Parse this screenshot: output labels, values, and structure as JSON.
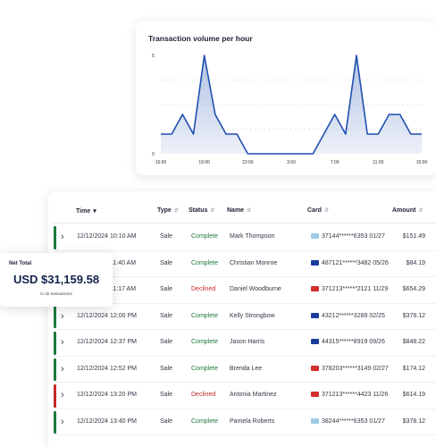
{
  "chart": {
    "title": "Transaction volume per hour",
    "chart_data": {
      "type": "area",
      "title": "Transaction volume per hour",
      "y_ticks": [
        "0",
        "5"
      ],
      "x_ticks": [
        "15:00",
        "19:00",
        "23:00",
        "3:00",
        "7:00",
        "11:00",
        "15:00"
      ],
      "ylim": [
        0,
        5
      ],
      "values": [
        1,
        1,
        2,
        1,
        5,
        2,
        1,
        1,
        0,
        0,
        0,
        0,
        0,
        0,
        0,
        1,
        2,
        1,
        5,
        1,
        1,
        2,
        2,
        1,
        1
      ],
      "color": "#1f4fb0"
    }
  },
  "table": {
    "headers": {
      "time": "Time",
      "type": "Type",
      "status": "Status",
      "name": "Name",
      "card": "Card",
      "amount": "Amount"
    },
    "rows": [
      {
        "time": "12/12/2024 10:10 AM",
        "type": "Sale",
        "status": "Complete",
        "name": "Mark Thompson",
        "card": "37144******6353 01/27",
        "amount": "$151.49",
        "brand": "amex"
      },
      {
        "time": "12/12/2024 11:40 AM",
        "type": "Sale",
        "status": "Complete",
        "name": "Christian Monroe",
        "card": "487121******3482 05/26",
        "amount": "$84.19",
        "brand": "visa"
      },
      {
        "time": "12/12/2024 11:17 AM",
        "type": "Sale",
        "status": "Declined",
        "name": "Daniel Woodburne",
        "card": "371213******2121 11/29",
        "amount": "$654.29",
        "brand": "mastercard"
      },
      {
        "time": "12/12/2024 12:00 PM",
        "type": "Sale",
        "status": "Complete",
        "name": "Kelly Strongbow",
        "card": "43212******3289 02/25",
        "amount": "$378.12",
        "brand": "visa"
      },
      {
        "time": "12/12/2024 12:37 PM",
        "type": "Sale",
        "status": "Complete",
        "name": "Jason Harris",
        "card": "44315******8919 09/26",
        "amount": "$848.22",
        "brand": "visa"
      },
      {
        "time": "12/12/2024 12:52 PM",
        "type": "Sale",
        "status": "Complete",
        "name": "Brenda Lee",
        "card": "378203******3149 02/27",
        "amount": "$174.12",
        "brand": "mastercard"
      },
      {
        "time": "12/12/2024 13:20 PM",
        "type": "Sale",
        "status": "Declined",
        "name": "Antonia Martinez",
        "card": "371213******4423 11/26",
        "amount": "$614.19",
        "brand": "mastercard"
      },
      {
        "time": "12/12/2024 13:40 PM",
        "type": "Sale",
        "status": "Complete",
        "name": "Pamela Roberts",
        "card": "38244******6353 01/27",
        "amount": "$378.12",
        "brand": "amex"
      }
    ]
  },
  "net_total": {
    "label": "Net Total",
    "value": "USD $31,159.58",
    "sub": "In 32 transactions"
  },
  "colors": {
    "complete": "#1e7a3c",
    "declined": "#c62828",
    "accent": "#1f4fb0",
    "amex": "#9fcbe8",
    "visa": "#1a3c9e",
    "mastercard": "#d32f2f"
  }
}
